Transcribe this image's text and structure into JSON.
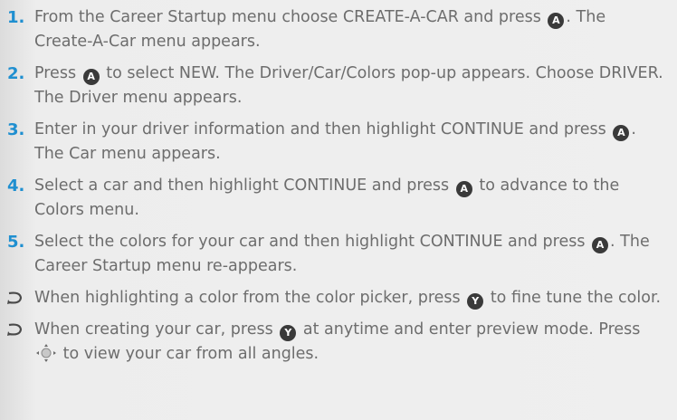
{
  "steps": [
    {
      "num": "1.",
      "before": "From the Career Startup menu choose CREATE-A-CAR and press",
      "button": "A",
      "after": ". The Create-A-Car menu appears."
    },
    {
      "num": "2.",
      "before": "Press",
      "button": "A",
      "after": "to select NEW. The Driver/Car/Colors pop-up appears. Choose DRIVER. The Driver menu appears."
    },
    {
      "num": "3.",
      "before": "Enter in your driver information and then highlight CONTINUE and press",
      "button": "A",
      "after": ". The Car menu appears."
    },
    {
      "num": "4.",
      "before": "Select a car and then highlight CONTINUE and press",
      "button": "A",
      "after": "to advance to the Colors menu."
    },
    {
      "num": "5.",
      "before": "Select the colors for your car and then highlight CONTINUE and press",
      "button": "A",
      "after": ". The Career Startup menu re-appears."
    }
  ],
  "tips": [
    {
      "before": "When highlighting a color from the color picker, press",
      "button": "Y",
      "middle": "to fine tune the color.",
      "after": ""
    },
    {
      "before": "When creating your car, press",
      "button": "Y",
      "middle": "at anytime and enter preview mode. Press",
      "after": "to view your car from all angles.",
      "icon": "dpad-icon"
    }
  ],
  "colors": {
    "accent": "#1f8fd0",
    "text": "#6d6d6d",
    "button": "#3a3a3a"
  }
}
